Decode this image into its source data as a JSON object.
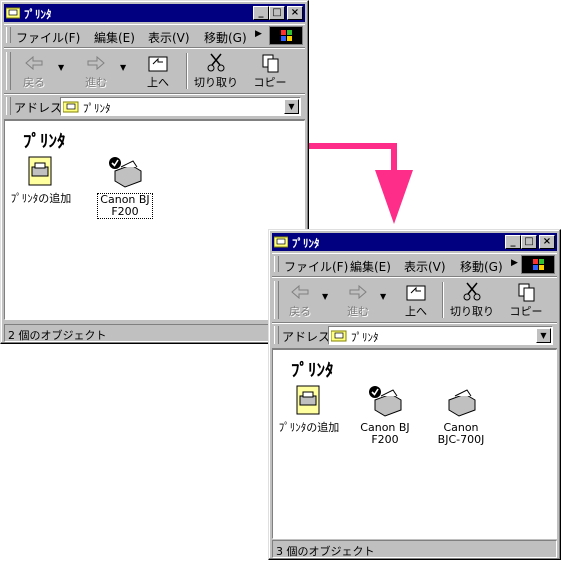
{
  "colors": {
    "arrow": "#ff2d8a",
    "titlebar": "#000080",
    "face": "#c0c0c0"
  },
  "window_back": {
    "title": "ﾌﾟﾘﾝﾀ",
    "menu": [
      "ファイル(F)",
      "編集(E)",
      "表示(V)",
      "移動(G)"
    ],
    "toolbar": {
      "back": "戻る",
      "forward": "進む",
      "up": "上へ",
      "cut": "切り取り",
      "copy": "コピー"
    },
    "address_label": "アドレス",
    "address_value": "ﾌﾟﾘﾝﾀ",
    "folder_title": "ﾌﾟﾘﾝﾀ",
    "items": [
      {
        "label": "ﾌﾟﾘﾝﾀの追加",
        "icon": "add-printer-icon"
      },
      {
        "label": "Canon BJ\nF200",
        "icon": "printer-default-icon"
      }
    ],
    "status": "2 個のオブジェクト"
  },
  "window_front": {
    "title": "ﾌﾟﾘﾝﾀ",
    "menu": [
      "ファイル(F)",
      "編集(E)",
      "表示(V)",
      "移動(G)"
    ],
    "toolbar": {
      "back": "戻る",
      "forward": "進む",
      "up": "上へ",
      "cut": "切り取り",
      "copy": "コピー"
    },
    "address_label": "アドレス",
    "address_value": "ﾌﾟﾘﾝﾀ",
    "folder_title": "ﾌﾟﾘﾝﾀ",
    "items": [
      {
        "label": "ﾌﾟﾘﾝﾀの追加",
        "icon": "add-printer-icon"
      },
      {
        "label": "Canon BJ\nF200",
        "icon": "printer-default-icon"
      },
      {
        "label": "Canon\nBJC-700J",
        "icon": "printer-icon"
      }
    ],
    "status": "3 個のオブジェクト"
  }
}
